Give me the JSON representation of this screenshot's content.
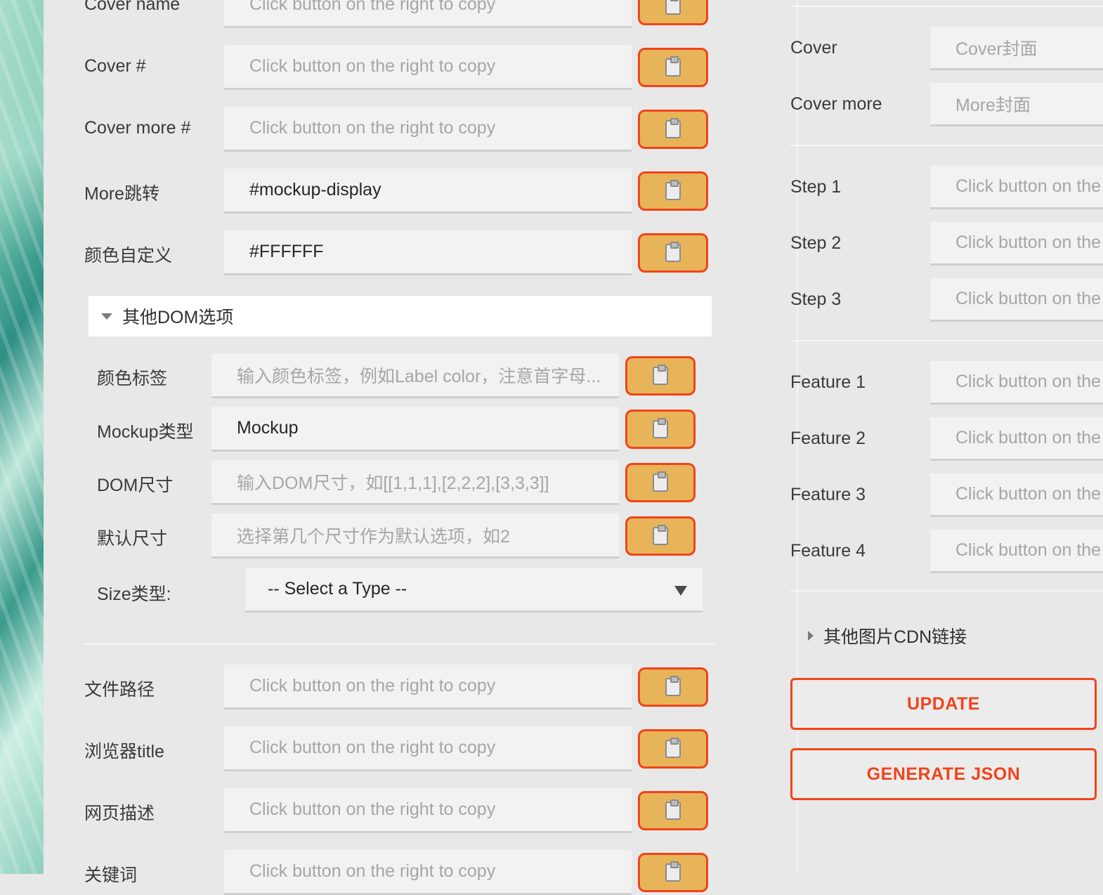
{
  "left": {
    "top_rows": [
      {
        "label": "Cover name",
        "value": "",
        "placeholder": "Click button on the right to copy"
      },
      {
        "label": "Cover #",
        "value": "",
        "placeholder": "Click button on the right to copy"
      },
      {
        "label": "Cover more #",
        "value": "",
        "placeholder": "Click button on the right to copy"
      },
      {
        "label": "More跳转",
        "value": "#mockup-display",
        "placeholder": ""
      },
      {
        "label": "颜色自定义",
        "value": "#FFFFFF",
        "placeholder": ""
      }
    ],
    "dom_section": {
      "title": "其他DOM选项",
      "rows": [
        {
          "label": "颜色标签",
          "value": "",
          "placeholder": "输入颜色标签，例如Label color，注意首字母..."
        },
        {
          "label": "Mockup类型",
          "value": "Mockup",
          "placeholder": ""
        },
        {
          "label": "DOM尺寸",
          "value": "",
          "placeholder": "输入DOM尺寸，如[[1,1,1],[2,2,2],[3,3,3]]"
        },
        {
          "label": "默认尺寸",
          "value": "",
          "placeholder": "选择第几个尺寸作为默认选项，如2"
        }
      ],
      "size_type_label": "Size类型:",
      "size_type_selected": "-- Select a Type --"
    },
    "bottom_rows": [
      {
        "label": "文件路径",
        "value": "",
        "placeholder": "Click button on the right to copy"
      },
      {
        "label": "浏览器title",
        "value": "",
        "placeholder": "Click button on the right to copy"
      },
      {
        "label": "网页描述",
        "value": "",
        "placeholder": "Click button on the right to copy"
      },
      {
        "label": "关键词",
        "value": "",
        "placeholder": "Click button on the right to copy"
      }
    ],
    "copy_icon": "clipboard-icon"
  },
  "right": {
    "cover_rows": [
      {
        "label": "Cover",
        "placeholder": "Cover封面"
      },
      {
        "label": "Cover more",
        "placeholder": "More封面"
      }
    ],
    "step_rows": [
      {
        "label": "Step 1",
        "placeholder": "Click button on the"
      },
      {
        "label": "Step 2",
        "placeholder": "Click button on the"
      },
      {
        "label": "Step 3",
        "placeholder": "Click button on the"
      }
    ],
    "feature_rows": [
      {
        "label": "Feature 1",
        "placeholder": "Click button on the"
      },
      {
        "label": "Feature 2",
        "placeholder": "Click button on the"
      },
      {
        "label": "Feature 3",
        "placeholder": "Click button on the"
      },
      {
        "label": "Feature 4",
        "placeholder": "Click button on the"
      }
    ],
    "cdn_section_title": "其他图片CDN链接",
    "update_label": "UPDATE",
    "generate_label": "GENERATE JSON"
  },
  "colors": {
    "accent": "#f0441a",
    "copy_button_fill": "#e8b45a",
    "panel_bg": "#e8e8e8",
    "input_bg": "#f2f2f2"
  }
}
